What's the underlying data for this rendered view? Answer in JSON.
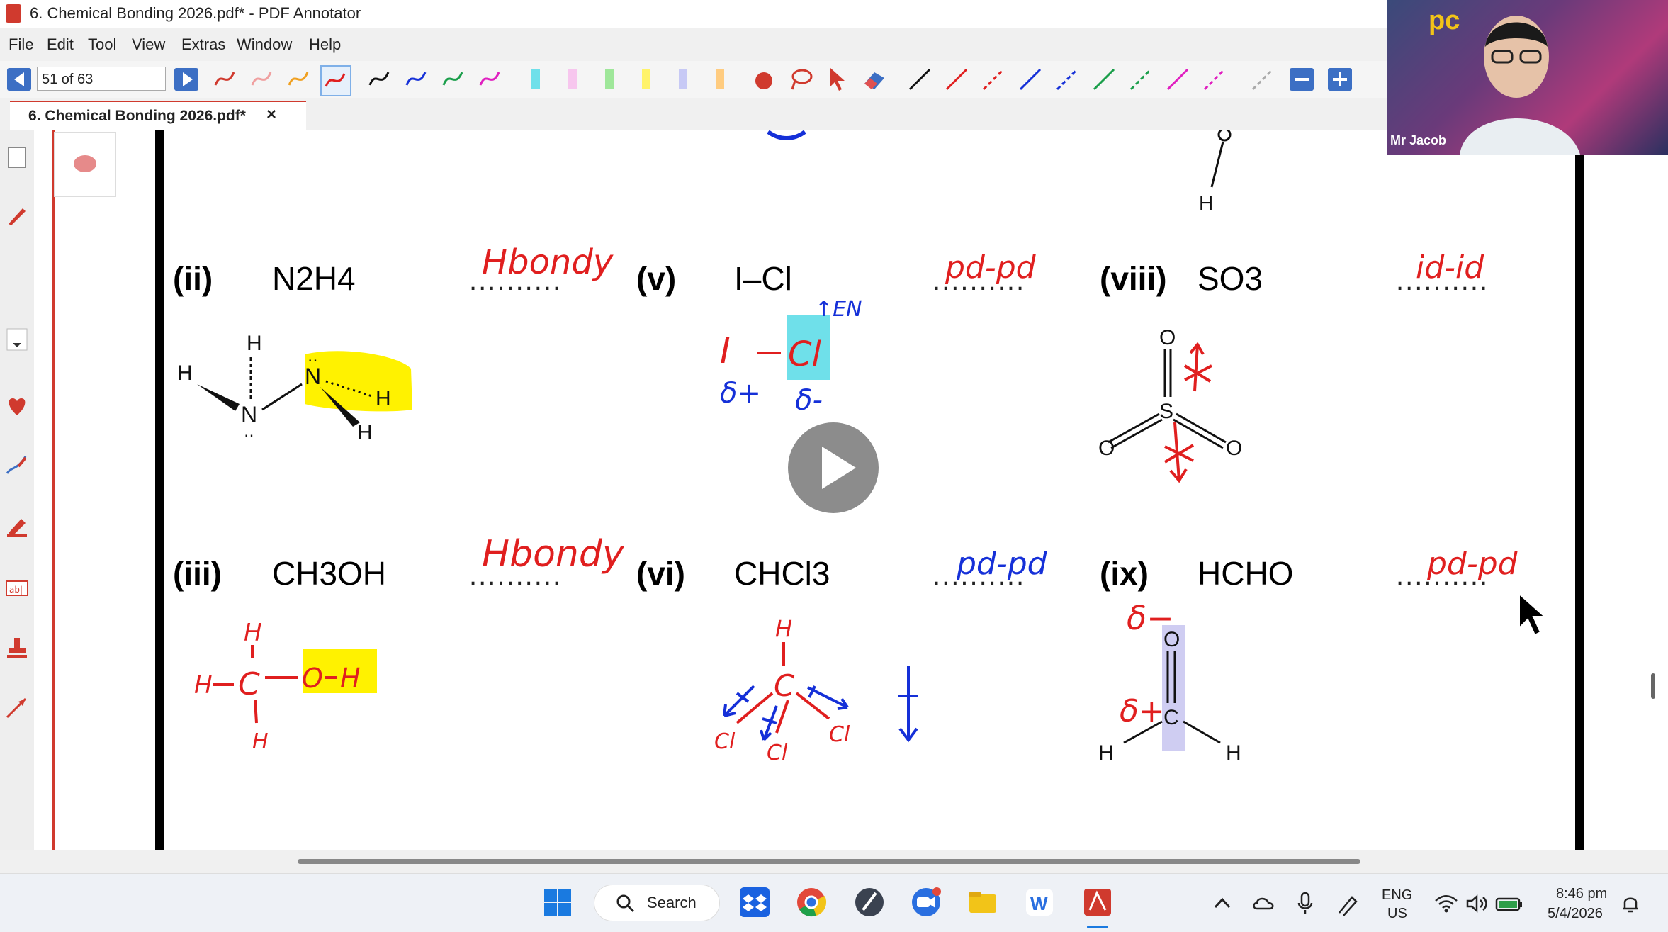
{
  "window": {
    "title": "6. Chemical Bonding 2026.pdf* - PDF Annotator"
  },
  "menu": [
    "File",
    "Edit",
    "Tool",
    "View",
    "Extras",
    "Window",
    "Help"
  ],
  "toolbar": {
    "page_indicator": "51 of 63"
  },
  "tab": {
    "label": "6. Chemical Bonding 2026.pdf*",
    "close": "×"
  },
  "video": {
    "presenter_name": "Mr Jacob",
    "logo": "pc"
  },
  "document": {
    "items": [
      {
        "num": "(ii)",
        "formula": "N2H4",
        "answer_dots": "..........",
        "handwritten": "Hbondy"
      },
      {
        "num": "(v)",
        "formula": "I–Cl",
        "answer_dots": "..........",
        "handwritten": "pd-pd"
      },
      {
        "num": "(viii)",
        "formula": "SO3",
        "answer_dots": "..........",
        "handwritten": "id-id"
      },
      {
        "num": "(iii)",
        "formula": "CH3OH",
        "answer_dots": "..........",
        "handwritten": "Hbondy"
      },
      {
        "num": "(vi)",
        "formula": "CHCl3",
        "answer_dots": "..........",
        "handwritten": "pd-pd"
      },
      {
        "num": "(ix)",
        "formula": "HCHO",
        "answer_dots": "..........",
        "handwritten": "pd-pd"
      }
    ],
    "atoms": {
      "H": "H",
      "N": "N",
      "O": "O",
      "S": "S",
      "C": "C",
      "Cl": "Cl",
      "I": "I"
    },
    "annotations": {
      "en": "↑EN",
      "delta_plus": "δ+",
      "delta_minus": "δ-",
      "delta_minus2": "δ−",
      "delta_plus2": "δ+"
    }
  },
  "taskbar": {
    "search_label": "Search",
    "lang_top": "ENG",
    "lang_bottom": "US",
    "time": "8:46 pm",
    "date": "5/4/2026"
  },
  "colors": {
    "accent": "#d03a2e",
    "ink_red": "#e01f1f",
    "ink_blue": "#1530d8",
    "highlight_yellow": "#fff200",
    "highlight_cyan": "#6fe0ea"
  }
}
